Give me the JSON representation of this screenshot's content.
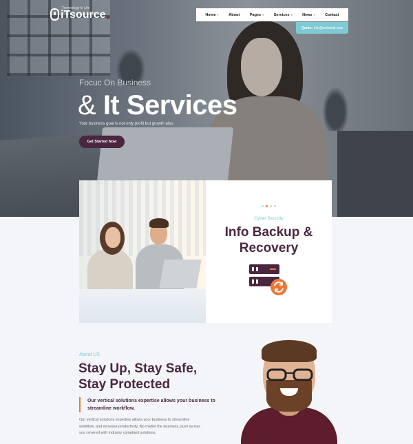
{
  "brand": {
    "name": "iTsource",
    "tagline": "Technology In Life"
  },
  "nav": {
    "items": [
      {
        "label": "Home",
        "has_dropdown": true
      },
      {
        "label": "About",
        "has_dropdown": false
      },
      {
        "label": "Pages",
        "has_dropdown": true
      },
      {
        "label": "Services",
        "has_dropdown": true
      },
      {
        "label": "News",
        "has_dropdown": true
      },
      {
        "label": "Contact",
        "has_dropdown": false
      }
    ],
    "chevron": "▾"
  },
  "quote": {
    "label": "Quote:",
    "email": "info@webmail.com"
  },
  "hero": {
    "subtitle": "Focuc On Business",
    "title_amp": "&",
    "title_main": "It Services",
    "description": "Your business goal is not only profit but growth also.",
    "button": "Get Started Now"
  },
  "feature": {
    "kicker": "Cyber Security",
    "title": "Info Backup & Recovery",
    "icon": "server-backup-icon",
    "slider_dots": 4,
    "active_dot": 2
  },
  "about": {
    "kicker": "About US",
    "title": "Stay Up, Stay Safe, Stay Protected",
    "lead": "Our vertical solutions expertise allows your business to streamline workflow.",
    "body": "Our vertical solutions expertise allows your business to streamline workflow, and increase productivity. No matter the business, pure as has you covered with industry compliant solutions."
  },
  "colors": {
    "brand_dark": "#4a2640",
    "accent_teal": "#7dcad5",
    "accent_orange": "#e8793b"
  }
}
